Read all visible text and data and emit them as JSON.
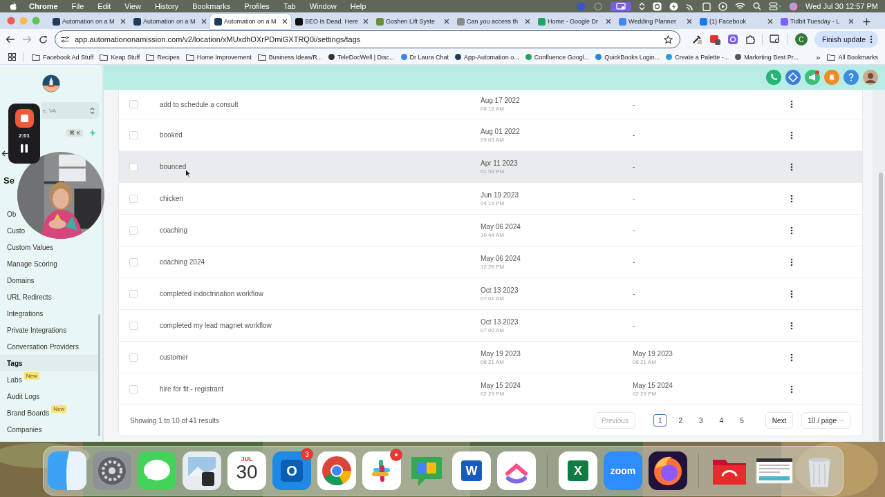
{
  "menu_bar": {
    "app": "Chrome",
    "menus": [
      "File",
      "Edit",
      "View",
      "History",
      "Bookmarks",
      "Profiles",
      "Tab",
      "Window",
      "Help"
    ],
    "clock": "Wed Jul 30 12:57 PM"
  },
  "tabs": [
    {
      "title": "Automation on a M",
      "color": "#1f3b57",
      "selected": false
    },
    {
      "title": "Automation on a M",
      "color": "#1f3b57",
      "selected": false
    },
    {
      "title": "Automation on a M",
      "color": "#1f3b57",
      "selected": true
    },
    {
      "title": "SEO Is Dead. Here",
      "color": "#111111",
      "selected": false
    },
    {
      "title": "Goshen Lift Syste",
      "color": "#6a8f3a",
      "selected": false
    },
    {
      "title": "Can you access th",
      "color": "#8a8a8a",
      "selected": false
    },
    {
      "title": "Home - Google Dr",
      "color": "#1fa463",
      "selected": false
    },
    {
      "title": "Wedding Planner",
      "color": "#4285f4",
      "selected": false
    },
    {
      "title": "(1) Facebook",
      "color": "#1877f2",
      "selected": false
    },
    {
      "title": "Tidbit Tuesday - L",
      "color": "#7b61ff",
      "selected": false
    }
  ],
  "toolbar": {
    "url": "app.automationonamission.com/v2/location/xMUxdhOXrPDmiGXTRQ0i/settings/tags",
    "profile": "C",
    "update_button": "Finish update"
  },
  "bookmarks": [
    {
      "label": "Facebook Ad Stuff",
      "kind": "folder"
    },
    {
      "label": "Keap Stuff",
      "kind": "folder"
    },
    {
      "label": "Recipes",
      "kind": "folder"
    },
    {
      "label": "Home Improvement",
      "kind": "folder"
    },
    {
      "label": "Business Ideas/R...",
      "kind": "folder"
    },
    {
      "label": "TeleDocWell | Disc...",
      "kind": "site",
      "color": "#333333"
    },
    {
      "label": "Dr Laura Chat",
      "kind": "site",
      "color": "#3b82f6"
    },
    {
      "label": "App-Automation o...",
      "kind": "site",
      "color": "#1f3b57"
    },
    {
      "label": "Confluence Googl...",
      "kind": "site",
      "color": "#1fa463"
    },
    {
      "label": "QuickBooks Login...",
      "kind": "site",
      "color": "#1e88e5"
    },
    {
      "label": "Create a Palette -...",
      "kind": "site",
      "color": "#2a9fd6"
    },
    {
      "label": "Marketing Best Pr...",
      "kind": "site",
      "color": "#555555"
    }
  ],
  "bookmarks_more": "»",
  "all_bookmarks": "All Bookmarks",
  "sidebar": {
    "location": "e, VA",
    "shortcut": "⌘ K",
    "heading": "Se",
    "items": [
      {
        "label": "Ob",
        "selected": false
      },
      {
        "label": "Custo",
        "selected": false
      },
      {
        "label": "Custom Values",
        "selected": false
      },
      {
        "label": "Manage Scoring",
        "selected": false
      },
      {
        "label": "Domains",
        "selected": false
      },
      {
        "label": "URL Redirects",
        "selected": false
      },
      {
        "label": "Integrations",
        "selected": false
      },
      {
        "label": "Private Integrations",
        "selected": false
      },
      {
        "label": "Conversation Providers",
        "selected": false
      },
      {
        "label": "Tags",
        "selected": true
      },
      {
        "label": "Labs",
        "selected": false,
        "badge": "New"
      },
      {
        "label": "Audit Logs",
        "selected": false
      },
      {
        "label": "Brand Boards",
        "selected": false,
        "badge": "New"
      },
      {
        "label": "Companies",
        "selected": false
      }
    ]
  },
  "recorder": {
    "time": "2:01"
  },
  "table": {
    "rows": [
      {
        "checked": false,
        "highlighted": false,
        "column_1": "add to schedule a consult",
        "column_2": {
          "date": "Aug 17 2022",
          "time": "08 16 AM"
        },
        "column_3": {
          "date": "-"
        }
      },
      {
        "checked": false,
        "highlighted": false,
        "column_1": "booked",
        "column_2": {
          "date": "Aug 01 2022",
          "time": "09 03 AM"
        },
        "column_3": {
          "date": "-"
        }
      },
      {
        "checked": false,
        "highlighted": true,
        "column_1": "bounced",
        "column_2": {
          "date": "Apr 11 2023",
          "time": "01 59 PM"
        },
        "column_3": {
          "date": "-"
        }
      },
      {
        "checked": false,
        "highlighted": false,
        "column_1": "chicken",
        "column_2": {
          "date": "Jun 19 2023",
          "time": "04 19 PM"
        },
        "column_3": {
          "date": "-"
        }
      },
      {
        "checked": false,
        "highlighted": false,
        "column_1": "coaching",
        "column_2": {
          "date": "May 06 2024",
          "time": "10 44 AM"
        },
        "column_3": {
          "date": "-"
        }
      },
      {
        "checked": false,
        "highlighted": false,
        "column_1": "coaching 2024",
        "column_2": {
          "date": "May 06 2024",
          "time": "12 28 PM"
        },
        "column_3": {
          "date": "-"
        }
      },
      {
        "checked": false,
        "highlighted": false,
        "column_1": "completed indoctrination workflow",
        "column_2": {
          "date": "Oct 13 2023",
          "time": "07 01 AM"
        },
        "column_3": {
          "date": "-"
        }
      },
      {
        "checked": false,
        "highlighted": false,
        "column_1": "completed my lead magnet workflow",
        "column_2": {
          "date": "Oct 13 2023",
          "time": "07 00 AM"
        },
        "column_3": {
          "date": "-"
        }
      },
      {
        "checked": false,
        "highlighted": false,
        "column_1": "customer",
        "column_2": {
          "date": "May 19 2023",
          "time": "08 21 AM"
        },
        "column_3": {
          "date": "May 19 2023",
          "time": "08 21 AM"
        }
      },
      {
        "checked": false,
        "highlighted": false,
        "column_1": "hire for fit - registrant",
        "column_2": {
          "date": "May 15 2024",
          "time": "02 29 PM"
        },
        "column_3": {
          "date": "May 15 2024",
          "time": "02 29 PM"
        }
      }
    ]
  },
  "pagination": {
    "summary": "Showing 1 to 10 of 41 results",
    "previous": {
      "label": "Previous",
      "disabled": true
    },
    "pages": [
      {
        "label": "1",
        "selected": true
      },
      {
        "label": "2",
        "selected": false
      },
      {
        "label": "3",
        "selected": false
      },
      {
        "label": "4",
        "selected": false
      },
      {
        "label": "5",
        "selected": false
      }
    ],
    "next": {
      "label": "Next",
      "disabled": false
    },
    "page_size": "10 / page"
  },
  "dock": [
    {
      "kind": "finder"
    },
    {
      "kind": "settings"
    },
    {
      "kind": "messages"
    },
    {
      "kind": "preview"
    },
    {
      "kind": "calendar",
      "month": "JUL",
      "day": "30"
    },
    {
      "kind": "outlook",
      "glyph": "O",
      "badge": "3"
    },
    {
      "kind": "chrome"
    },
    {
      "kind": "slack",
      "dot": true
    },
    {
      "kind": "chat"
    },
    {
      "kind": "word",
      "glyph": "W"
    },
    {
      "kind": "clickup"
    },
    {
      "kind": "separator"
    },
    {
      "kind": "excel",
      "glyph": "X"
    },
    {
      "kind": "zoom",
      "glyph": "zoom"
    },
    {
      "kind": "firefox"
    },
    {
      "kind": "separator"
    },
    {
      "kind": "folder"
    },
    {
      "kind": "thumbnail"
    },
    {
      "kind": "trash"
    }
  ]
}
